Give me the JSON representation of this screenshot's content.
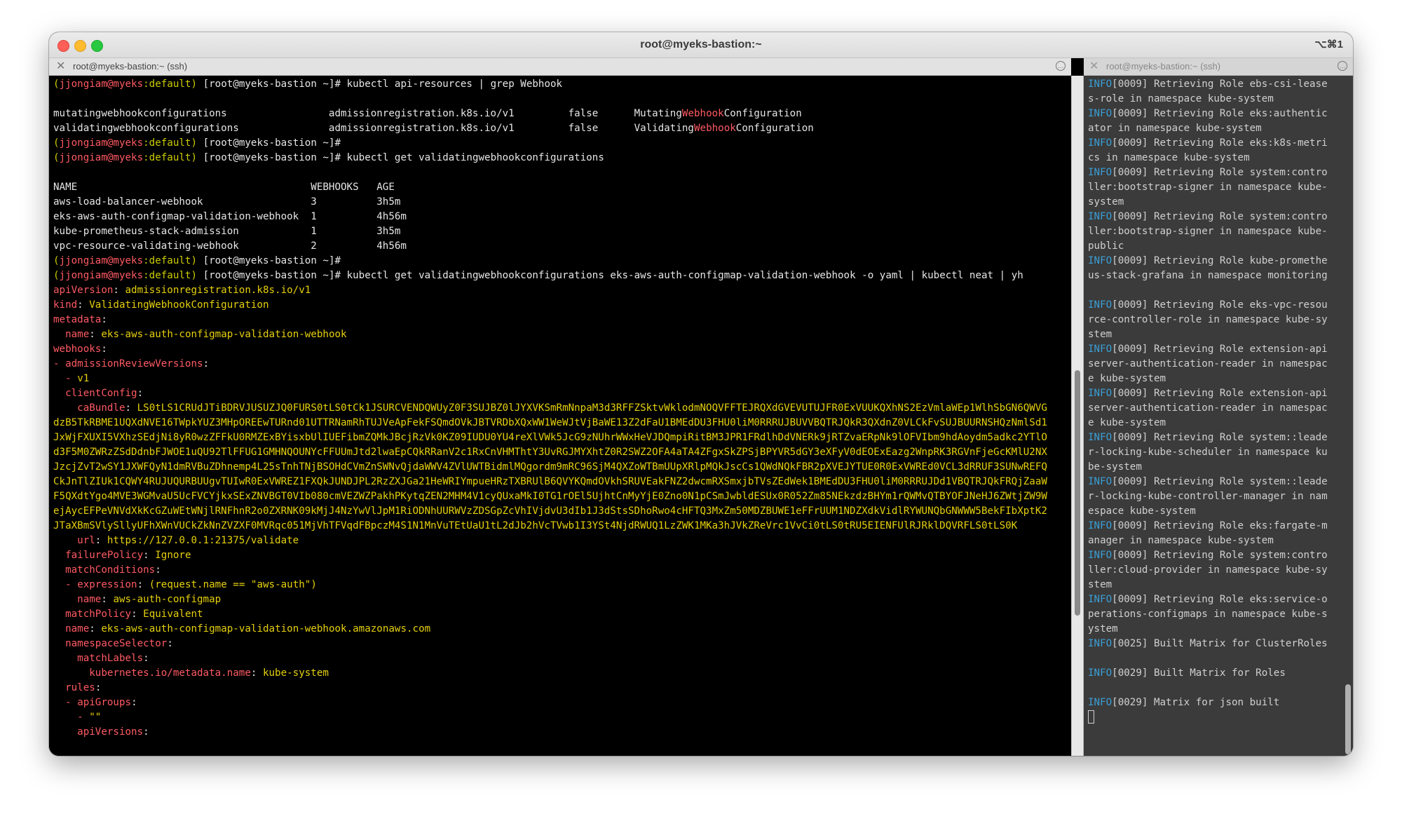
{
  "window": {
    "title": "root@myeks-bastion:~",
    "shortcut": "⌥⌘1"
  },
  "tabs": {
    "left_title": "root@myeks-bastion:~ (ssh)",
    "right_title": "root@myeks-bastion:~ (ssh)",
    "close_glyph": "✕",
    "menu_glyph": "…"
  },
  "prompt": {
    "user": "jjongiam@myeks",
    "ctx": ":default",
    "host": "[root@myeks-bastion ~]#"
  },
  "left": {
    "cmd1": "kubectl api-resources | grep Webhook",
    "api_rows": [
      {
        "name": "mutatingwebhookconfigurations",
        "group": "admissionregistration.k8s.io/v1",
        "namespaced": "false",
        "kind_pre": "Mutating",
        "kind_hl": "Webhook",
        "kind_post": "Configuration"
      },
      {
        "name": "validatingwebhookconfigurations",
        "group": "admissionregistration.k8s.io/v1",
        "namespaced": "false",
        "kind_pre": "Validating",
        "kind_hl": "Webhook",
        "kind_post": "Configuration"
      }
    ],
    "cmd2": "kubectl get validatingwebhookconfigurations",
    "table_header": {
      "name": "NAME",
      "webhooks": "WEBHOOKS",
      "age": "AGE"
    },
    "table_rows": [
      {
        "name": "aws-load-balancer-webhook",
        "webhooks": "3",
        "age": "3h5m"
      },
      {
        "name": "eks-aws-auth-configmap-validation-webhook",
        "webhooks": "1",
        "age": "4h56m"
      },
      {
        "name": "kube-prometheus-stack-admission",
        "webhooks": "1",
        "age": "3h5m"
      },
      {
        "name": "vpc-resource-validating-webhook",
        "webhooks": "2",
        "age": "4h56m"
      }
    ],
    "cmd3": "kubectl get validatingwebhookconfigurations eks-aws-auth-configmap-validation-webhook -o yaml | kubectl neat | yh",
    "yaml": [
      {
        "i": "",
        "d": "",
        "k": "apiVersion",
        "v": "admissionregistration.k8s.io/v1"
      },
      {
        "i": "",
        "d": "",
        "k": "kind",
        "v": "ValidatingWebhookConfiguration"
      },
      {
        "i": "",
        "d": "",
        "k": "metadata",
        "v": ""
      },
      {
        "i": "  ",
        "d": "",
        "k": "name",
        "v": "eks-aws-auth-configmap-validation-webhook"
      },
      {
        "i": "",
        "d": "",
        "k": "webhooks",
        "v": ""
      },
      {
        "i": "",
        "d": "- ",
        "k": "admissionReviewVersions",
        "v": ""
      },
      {
        "i": "  ",
        "d": "- ",
        "k": "",
        "v": "v1"
      },
      {
        "i": "  ",
        "d": "",
        "k": "clientConfig",
        "v": ""
      },
      {
        "i": "    ",
        "d": "",
        "k": "caBundle",
        "v": "LS0tLS1CRUdJTiBDRVJUSUZJQ0FURS0tLS0tCk1JSURCVENDQWUyZ0F3SUJBZ0lJYXVKSmRmNnpaM3d3RFFZSktvWklodmNOQVFFTEJRQXdGVEVUTUJFR0ExVUUKQXhNS2EzVmlaWEp1WlhSbGN6QWVG"
      },
      {
        "i": "",
        "d": "",
        "k": "",
        "v": "dzB5TkRBME1UQXdNVE16TWpkYUZ3MHpOREEwTURnd01UTTRNamRhTUJVeApFekFSQmdOVkJBTVRDbXQxWW1WeWJtVjBaWE13Z2dFaU1BMEdDU3FHU0liM0RRRUJBUVVBQTRJQkR3QXdnZ0VLCkFvSUJBUURNSHQzNmlSd1"
      },
      {
        "i": "",
        "d": "",
        "k": "",
        "v": "JxWjFXUXI5VXhzSEdjNi8yR0wzZFFkU0RMZExBYisxbUlIUEFibmZQMkJBcjRzVk0KZ09IUDU0YU4reXlVWk5JcG9zNUhrWWxHeVJDQmpiRitBM3JPR1FRdlhDdVNERk9jRTZvaERpNk9lOFVIbm9hdAoydm5adkc2YTlO"
      },
      {
        "i": "",
        "d": "",
        "k": "",
        "v": "d3F5M0ZWRzZSdDdnbFJWOE1uQU92TlFFUG1GMHNQOUNYcFFUUmJtd2lwaEpCQkRRanV2c1RxCnVHMThtY3UvRGJMYXhtZ0R2SWZ2OFA4aTA4ZFgxSkZPSjBPYVR5dGY3eXFyV0dEOExEazg2WnpRK3RGVnFjeGcKMlU2NX"
      },
      {
        "i": "",
        "d": "",
        "k": "",
        "v": "JzcjZvT2wSY1JXWFQyN1dmRVBuZDhnemp4L25sTnhTNjBSOHdCVmZnSWNvQjdaWWV4ZVlUWTBidmlMQgordm9mRC96SjM4QXZoWTBmUUpXRlpMQkJscCs1QWdNQkFBR2pXVEJYTUE0R0ExVWREd0VCL3dRRUF3SUNwREFQ"
      },
      {
        "i": "",
        "d": "",
        "k": "",
        "v": "CkJnTlZIUk1CQWY4RUJUQURBUUgvTUIwR0ExVWREZ1FXQkJUNDJPL2RzZXJGa21HeWRIYmpueHRzTXBRUlB6QVYKQmdOVkhSRUVEakFNZ2dwcmRXSmxjbTVsZEdWek1BMEdDU3FHU0liM0RRRUJDd1VBQTRJQkFRQjZaaW"
      },
      {
        "i": "",
        "d": "",
        "k": "",
        "v": "F5QXdtYgo4MVE3WGMvaU5UcFVCYjkxSExZNVBGT0VIb080cmVEZWZPakhPKytqZEN2MHM4V1cyQUxaMkI0TG1rOEl5UjhtCnMyYjE0Zno0N1pCSmJwbldESUx0R052Zm85NEkzdzBHYm1rQWMvQTBYOFJNeHJ6ZWtjZW9W"
      },
      {
        "i": "",
        "d": "",
        "k": "",
        "v": "ejAycEFPeVNVdXkKcGZuWEtWNjlRNFhnR2o0ZXRNK09kMjJ4NzYwVlJpM1RiODNhUURWVzZDSGpZcVhIVjdvU3dIb1J3dStsSDhoRwo4cHFTQ3MxZm50MDZBUWE1eFFrUUM1NDZXdkVidlRYWUNQbGNWWW5BekFIbXptK2"
      },
      {
        "i": "",
        "d": "",
        "k": "",
        "v": "JTaXBmSVlySllyUFhXWnVUCkZkNnZVZXF0MVRqc051MjVhTFVqdFBpczM4S1N1MnVuTEtUaU1tL2dJb2hVcTVwb1I3YSt4NjdRWUQ1LzZWK1MKa3hJVkZReVrc1VvCi0tLS0tRU5EIENFUlRJRklDQVRFLS0tLS0K"
      },
      {
        "i": "    ",
        "d": "",
        "k": "url",
        "v": "https://127.0.0.1:21375/validate"
      },
      {
        "i": "  ",
        "d": "",
        "k": "failurePolicy",
        "v": "Ignore"
      },
      {
        "i": "  ",
        "d": "",
        "k": "matchConditions",
        "v": ""
      },
      {
        "i": "  ",
        "d": "- ",
        "k": "expression",
        "v": "(request.name == \"aws-auth\")"
      },
      {
        "i": "    ",
        "d": "",
        "k": "name",
        "v": "aws-auth-configmap"
      },
      {
        "i": "  ",
        "d": "",
        "k": "matchPolicy",
        "v": "Equivalent"
      },
      {
        "i": "  ",
        "d": "",
        "k": "name",
        "v": "eks-aws-auth-configmap-validation-webhook.amazonaws.com"
      },
      {
        "i": "  ",
        "d": "",
        "k": "namespaceSelector",
        "v": ""
      },
      {
        "i": "    ",
        "d": "",
        "k": "matchLabels",
        "v": ""
      },
      {
        "i": "      ",
        "d": "",
        "k": "kubernetes.io/metadata.name",
        "v": "kube-system"
      },
      {
        "i": "  ",
        "d": "",
        "k": "rules",
        "v": ""
      },
      {
        "i": "  ",
        "d": "- ",
        "k": "apiGroups",
        "v": ""
      },
      {
        "i": "    ",
        "d": "- ",
        "k": "",
        "v": "\"\""
      },
      {
        "i": "    ",
        "d": "",
        "k": "apiVersions",
        "v": ""
      }
    ]
  },
  "right": {
    "lines": [
      {
        "info": "INFO",
        "t": "[0009] Retrieving Role ebs-csi-lease"
      },
      {
        "info": "",
        "t": "s-role in namespace kube-system"
      },
      {
        "info": "INFO",
        "t": "[0009] Retrieving Role eks:authentic"
      },
      {
        "info": "",
        "t": "ator in namespace kube-system"
      },
      {
        "info": "INFO",
        "t": "[0009] Retrieving Role eks:k8s-metri"
      },
      {
        "info": "",
        "t": "cs in namespace kube-system"
      },
      {
        "info": "INFO",
        "t": "[0009] Retrieving Role system:contro"
      },
      {
        "info": "",
        "t": "ller:bootstrap-signer in namespace kube-"
      },
      {
        "info": "",
        "t": "system"
      },
      {
        "info": "INFO",
        "t": "[0009] Retrieving Role system:contro"
      },
      {
        "info": "",
        "t": "ller:bootstrap-signer in namespace kube-"
      },
      {
        "info": "",
        "t": "public"
      },
      {
        "info": "INFO",
        "t": "[0009] Retrieving Role kube-promethe"
      },
      {
        "info": "",
        "t": "us-stack-grafana in namespace monitoring"
      },
      {
        "info": "",
        "t": ""
      },
      {
        "info": "INFO",
        "t": "[0009] Retrieving Role eks-vpc-resou"
      },
      {
        "info": "",
        "t": "rce-controller-role in namespace kube-sy"
      },
      {
        "info": "",
        "t": "stem"
      },
      {
        "info": "INFO",
        "t": "[0009] Retrieving Role extension-api"
      },
      {
        "info": "",
        "t": "server-authentication-reader in namespac"
      },
      {
        "info": "",
        "t": "e kube-system"
      },
      {
        "info": "INFO",
        "t": "[0009] Retrieving Role extension-api"
      },
      {
        "info": "",
        "t": "server-authentication-reader in namespac"
      },
      {
        "info": "",
        "t": "e kube-system"
      },
      {
        "info": "INFO",
        "t": "[0009] Retrieving Role system::leade"
      },
      {
        "info": "",
        "t": "r-locking-kube-scheduler in namespace ku"
      },
      {
        "info": "",
        "t": "be-system"
      },
      {
        "info": "INFO",
        "t": "[0009] Retrieving Role system::leade"
      },
      {
        "info": "",
        "t": "r-locking-kube-controller-manager in nam"
      },
      {
        "info": "",
        "t": "espace kube-system"
      },
      {
        "info": "INFO",
        "t": "[0009] Retrieving Role eks:fargate-m"
      },
      {
        "info": "",
        "t": "anager in namespace kube-system"
      },
      {
        "info": "INFO",
        "t": "[0009] Retrieving Role system:contro"
      },
      {
        "info": "",
        "t": "ller:cloud-provider in namespace kube-sy"
      },
      {
        "info": "",
        "t": "stem"
      },
      {
        "info": "INFO",
        "t": "[0009] Retrieving Role eks:service-o"
      },
      {
        "info": "",
        "t": "perations-configmaps in namespace kube-s"
      },
      {
        "info": "",
        "t": "ystem"
      },
      {
        "info": "INFO",
        "t": "[0025] Built Matrix for ClusterRoles"
      },
      {
        "info": "",
        "t": ""
      },
      {
        "info": "INFO",
        "t": "[0029] Built Matrix for Roles"
      },
      {
        "info": "",
        "t": ""
      },
      {
        "info": "INFO",
        "t": "[0029] Matrix for json built"
      },
      {
        "info": "",
        "t": ""
      }
    ]
  },
  "colors": {
    "prompt_paren": "#cccc00",
    "prompt_user": "#ff5a63",
    "yaml_key": "#ff5a63",
    "yaml_value": "#e5d00c",
    "info": "#3a9fd6",
    "highlight": "#ff5a63"
  }
}
